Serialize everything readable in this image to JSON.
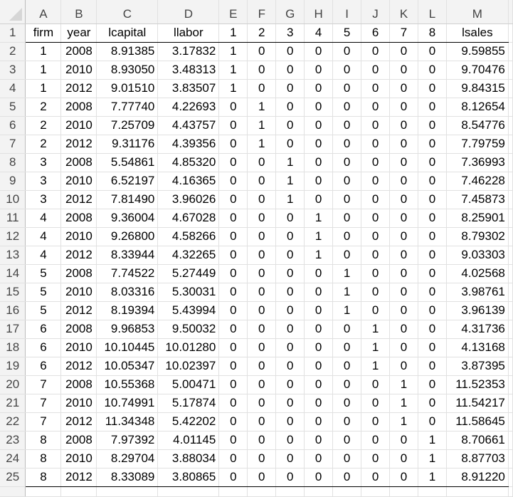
{
  "spreadsheet": {
    "column_letters": [
      "A",
      "B",
      "C",
      "D",
      "E",
      "F",
      "G",
      "H",
      "I",
      "J",
      "K",
      "L",
      "M"
    ],
    "headers": [
      "firm",
      "year",
      "lcapital",
      "llabor",
      "1",
      "2",
      "3",
      "4",
      "5",
      "6",
      "7",
      "8",
      "lsales"
    ],
    "row_numbers": [
      "1",
      "2",
      "3",
      "4",
      "5",
      "6",
      "7",
      "8",
      "9",
      "10",
      "11",
      "12",
      "13",
      "14",
      "15",
      "16",
      "17",
      "18",
      "19",
      "20",
      "21",
      "22",
      "23",
      "24",
      "25"
    ],
    "rows": [
      [
        "1",
        "2008",
        "8.91385",
        "3.17832",
        "1",
        "0",
        "0",
        "0",
        "0",
        "0",
        "0",
        "0",
        "9.59855"
      ],
      [
        "1",
        "2010",
        "8.93050",
        "3.48313",
        "1",
        "0",
        "0",
        "0",
        "0",
        "0",
        "0",
        "0",
        "9.70476"
      ],
      [
        "1",
        "2012",
        "9.01510",
        "3.83507",
        "1",
        "0",
        "0",
        "0",
        "0",
        "0",
        "0",
        "0",
        "9.84315"
      ],
      [
        "2",
        "2008",
        "7.77740",
        "4.22693",
        "0",
        "1",
        "0",
        "0",
        "0",
        "0",
        "0",
        "0",
        "8.12654"
      ],
      [
        "2",
        "2010",
        "7.25709",
        "4.43757",
        "0",
        "1",
        "0",
        "0",
        "0",
        "0",
        "0",
        "0",
        "8.54776"
      ],
      [
        "2",
        "2012",
        "9.31176",
        "4.39356",
        "0",
        "1",
        "0",
        "0",
        "0",
        "0",
        "0",
        "0",
        "7.79759"
      ],
      [
        "3",
        "2008",
        "5.54861",
        "4.85320",
        "0",
        "0",
        "1",
        "0",
        "0",
        "0",
        "0",
        "0",
        "7.36993"
      ],
      [
        "3",
        "2010",
        "6.52197",
        "4.16365",
        "0",
        "0",
        "1",
        "0",
        "0",
        "0",
        "0",
        "0",
        "7.46228"
      ],
      [
        "3",
        "2012",
        "7.81490",
        "3.96026",
        "0",
        "0",
        "1",
        "0",
        "0",
        "0",
        "0",
        "0",
        "7.45873"
      ],
      [
        "4",
        "2008",
        "9.36004",
        "4.67028",
        "0",
        "0",
        "0",
        "1",
        "0",
        "0",
        "0",
        "0",
        "8.25901"
      ],
      [
        "4",
        "2010",
        "9.26800",
        "4.58266",
        "0",
        "0",
        "0",
        "1",
        "0",
        "0",
        "0",
        "0",
        "8.79302"
      ],
      [
        "4",
        "2012",
        "8.33944",
        "4.32265",
        "0",
        "0",
        "0",
        "1",
        "0",
        "0",
        "0",
        "0",
        "9.03303"
      ],
      [
        "5",
        "2008",
        "7.74522",
        "5.27449",
        "0",
        "0",
        "0",
        "0",
        "1",
        "0",
        "0",
        "0",
        "4.02568"
      ],
      [
        "5",
        "2010",
        "8.03316",
        "5.30031",
        "0",
        "0",
        "0",
        "0",
        "1",
        "0",
        "0",
        "0",
        "3.98761"
      ],
      [
        "5",
        "2012",
        "8.19394",
        "5.43994",
        "0",
        "0",
        "0",
        "0",
        "1",
        "0",
        "0",
        "0",
        "3.96139"
      ],
      [
        "6",
        "2008",
        "9.96853",
        "9.50032",
        "0",
        "0",
        "0",
        "0",
        "0",
        "1",
        "0",
        "0",
        "4.31736"
      ],
      [
        "6",
        "2010",
        "10.10445",
        "10.01280",
        "0",
        "0",
        "0",
        "0",
        "0",
        "1",
        "0",
        "0",
        "4.13168"
      ],
      [
        "6",
        "2012",
        "10.05347",
        "10.02397",
        "0",
        "0",
        "0",
        "0",
        "0",
        "1",
        "0",
        "0",
        "3.87395"
      ],
      [
        "7",
        "2008",
        "10.55368",
        "5.00471",
        "0",
        "0",
        "0",
        "0",
        "0",
        "0",
        "1",
        "0",
        "11.52353"
      ],
      [
        "7",
        "2010",
        "10.74991",
        "5.17874",
        "0",
        "0",
        "0",
        "0",
        "0",
        "0",
        "1",
        "0",
        "11.54217"
      ],
      [
        "7",
        "2012",
        "11.34348",
        "5.42202",
        "0",
        "0",
        "0",
        "0",
        "0",
        "0",
        "1",
        "0",
        "11.58645"
      ],
      [
        "8",
        "2008",
        "7.97392",
        "4.01145",
        "0",
        "0",
        "0",
        "0",
        "0",
        "0",
        "0",
        "1",
        "8.70661"
      ],
      [
        "8",
        "2010",
        "8.29704",
        "3.88034",
        "0",
        "0",
        "0",
        "0",
        "0",
        "0",
        "0",
        "1",
        "8.87703"
      ],
      [
        "8",
        "2012",
        "8.33089",
        "3.80865",
        "0",
        "0",
        "0",
        "0",
        "0",
        "0",
        "0",
        "1",
        "8.91220"
      ]
    ]
  }
}
